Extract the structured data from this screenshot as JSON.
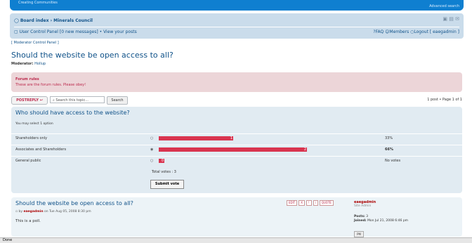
{
  "header": {
    "left_text": "Creating Communities",
    "right_text": "Advanced search"
  },
  "nav": {
    "board_index": "Board index",
    "forum": "Minerals Council",
    "separator": "›",
    "icons": [
      "font-size-icon",
      "print-icon",
      "email-icon"
    ],
    "ucp": "User Control Panel",
    "new_messages": "0 new messages",
    "bullet": "•",
    "view_posts": "View your posts",
    "faq": "FAQ",
    "members": "Members",
    "logout": "Logout [ eaegadmin ]"
  },
  "mcp_link": "[ Moderator Control Panel ]",
  "topic": {
    "title": "Should the website be open access to all?",
    "moderators_label": "Moderator:",
    "moderator": "Hollup"
  },
  "rules": {
    "heading": "Forum rules",
    "text": "These are the forum rules. Please obey!"
  },
  "actions": {
    "postreply": "POSTREPLY",
    "search_placeholder": "Search this topic...",
    "search_button": "Search",
    "page_info": "1 post • Page 1 of 1"
  },
  "poll": {
    "question": "Who should have access to the website?",
    "subtitle": "You may select 1 option",
    "options": [
      {
        "label": "Shareholders only",
        "votes": "1",
        "percent": "33%",
        "fraction": 0.33
      },
      {
        "label": "Associates and Shareholders",
        "votes": "2",
        "percent": "66%",
        "fraction": 0.66
      },
      {
        "label": "General public",
        "votes": "0",
        "percent": "No votes",
        "fraction": 0.0
      }
    ],
    "total": "Total votes : 3",
    "submit": "Submit vote",
    "bar_color": "#d9344f"
  },
  "post": {
    "title": "Should the website be open access to all?",
    "by_prefix": "by",
    "author": "eaegadmin",
    "date": "on Tue Aug 05, 2008 8:30 pm",
    "body": "This is a poll.",
    "buttons": [
      "EDIT",
      "X",
      "!",
      "i",
      "QUOTE"
    ],
    "profile": {
      "username": "eaegadmin",
      "rank": "Site Admin",
      "posts_label": "Posts:",
      "posts": "3",
      "joined_label": "Joined:",
      "joined": "Mon Jul 21, 2008 6:46 pm",
      "pm": "PM"
    }
  },
  "status": "Done",
  "colors": {
    "header": "#0f7fd0",
    "nav": "#cadceb",
    "link": "#105289",
    "rules_bg": "#ecd5d8",
    "poll_bg": "#e1ebf2",
    "post_bg": "#ecf3f7"
  }
}
